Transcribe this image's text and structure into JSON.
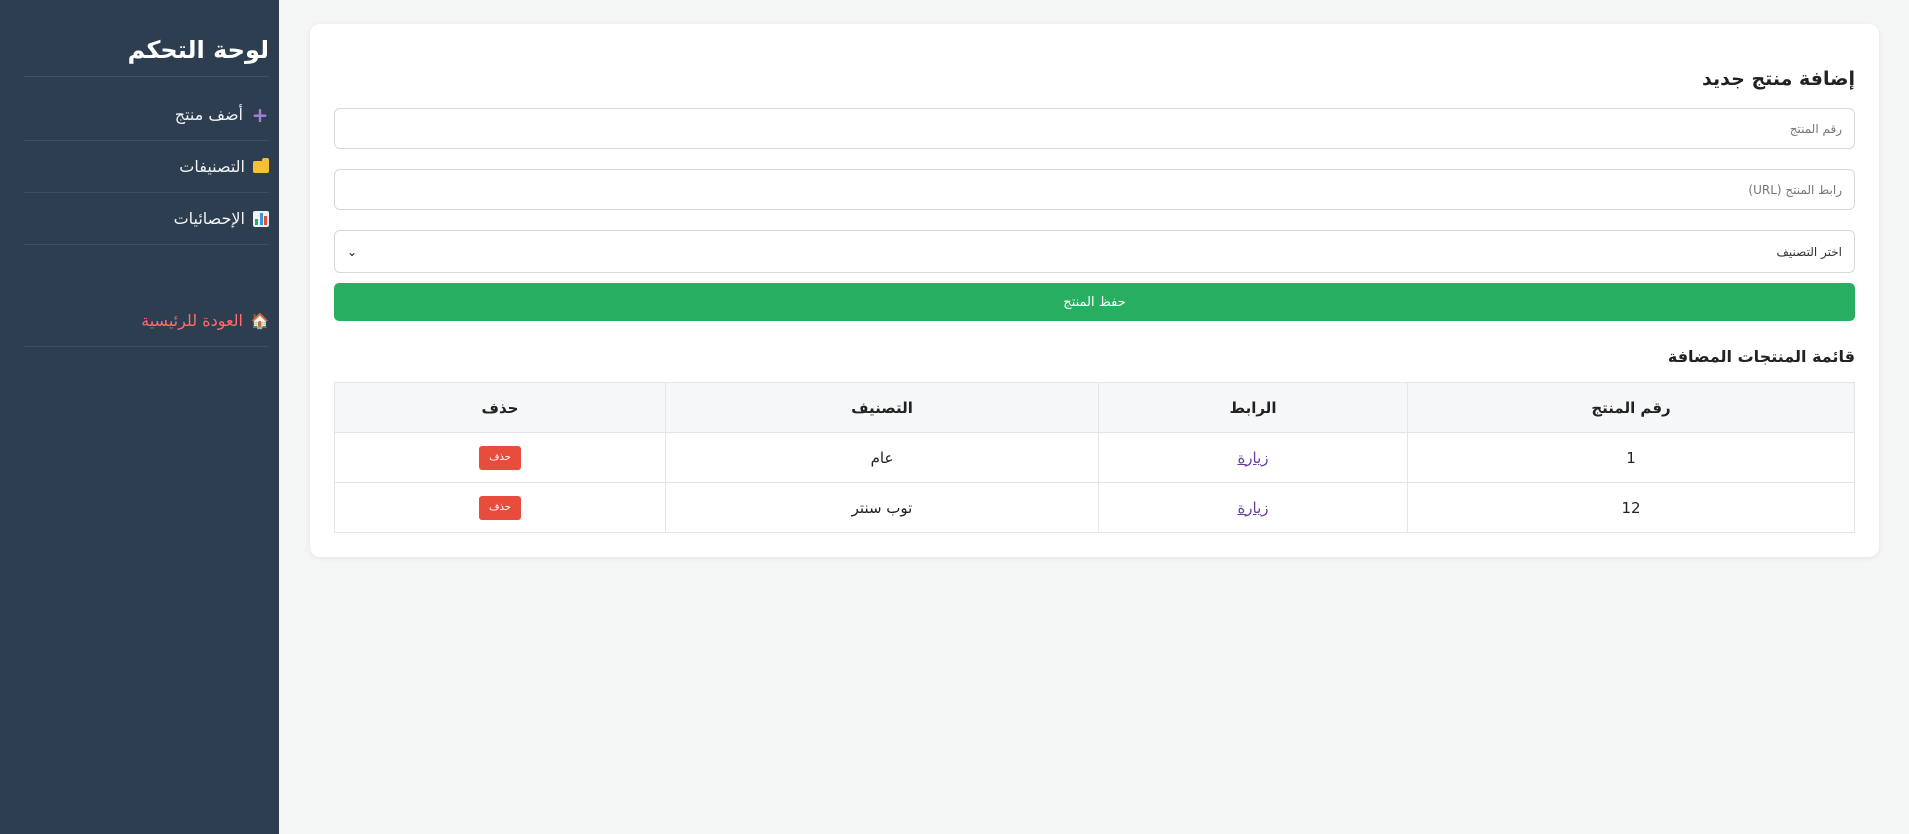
{
  "sidebar": {
    "title": "لوحة التحكم",
    "items": [
      {
        "label": "أضف منتج",
        "icon": "plus-icon"
      },
      {
        "label": "التصنيفات",
        "icon": "folder-icon"
      },
      {
        "label": "الإحصائيات",
        "icon": "bar-chart-icon"
      }
    ],
    "home": {
      "label": "العودة للرئيسية",
      "icon": "house-icon"
    }
  },
  "form": {
    "title": "إضافة منتج جديد",
    "product_id_placeholder": "رقم المنتج",
    "product_url_placeholder": "رابط المنتج (URL)",
    "category_select": "اختر التصنيف",
    "save_label": "حفظ المنتج"
  },
  "list": {
    "title": "قائمة المنتجات المضافة",
    "columns": [
      "رقم المنتج",
      "الرابط",
      "التصنيف",
      "حذف"
    ],
    "rows": [
      {
        "id": "1",
        "link": "زيارة",
        "category": "عام",
        "delete": "حذف"
      },
      {
        "id": "12",
        "link": "زيارة",
        "category": "توب سنتر",
        "delete": "حذف"
      }
    ]
  },
  "colors": {
    "sidebar_bg": "#2c3e50",
    "save_button": "#27ae60",
    "delete_button": "#e74c3c",
    "home_link": "#ff6b6b"
  }
}
